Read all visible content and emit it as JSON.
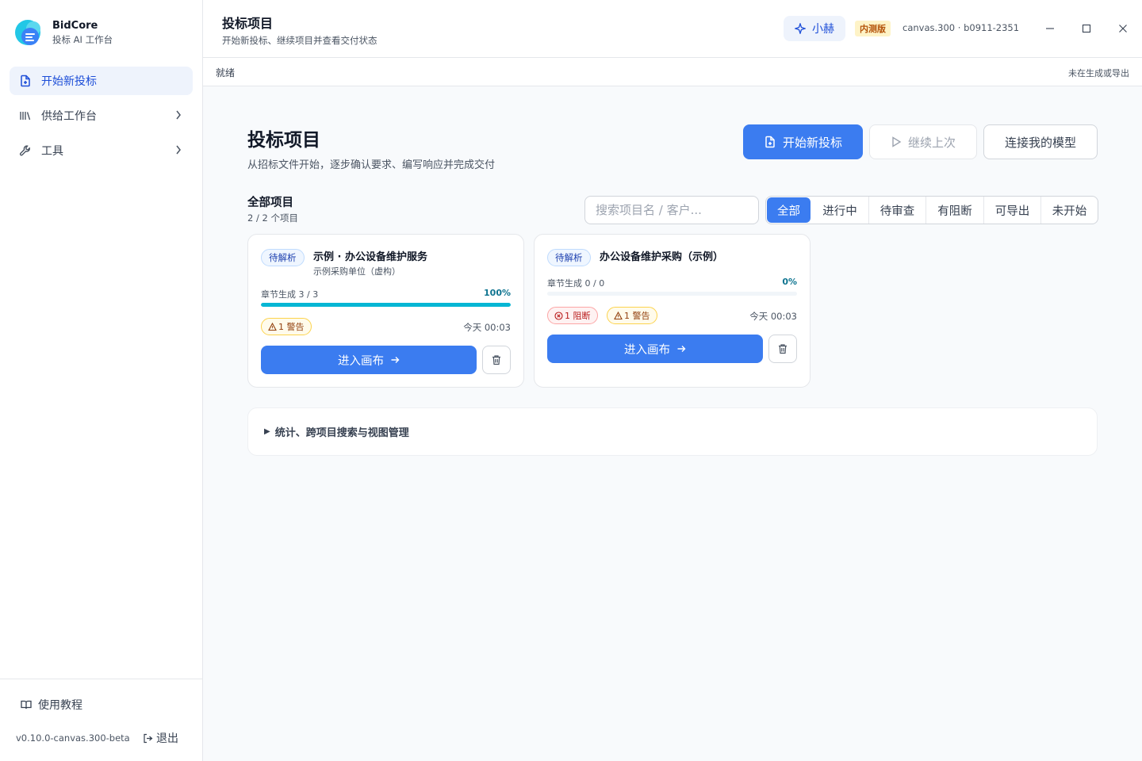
{
  "brand": {
    "name": "BidCore",
    "subtitle": "投标 AI 工作台"
  },
  "sidebar": {
    "items": [
      {
        "label": "开始新投标",
        "icon": "file-plus-icon",
        "active": true
      },
      {
        "label": "供给工作台",
        "icon": "library-icon",
        "active": false
      },
      {
        "label": "工具",
        "icon": "wrench-icon",
        "active": false
      }
    ],
    "tutorial_label": "使用教程",
    "version": "v0.10.0-canvas.300-beta",
    "logout_label": "退出"
  },
  "topbar": {
    "title": "投标项目",
    "subtitle": "开始新投标、继续项目并查看交付状态",
    "assistant_label": "小赫",
    "beta_label": "内测版",
    "build": "canvas.300 · b0911-2351"
  },
  "statusbar": {
    "left": "就绪",
    "right": "未在生成或导出"
  },
  "main": {
    "title": "投标项目",
    "subtitle": "从招标文件开始，逐步确认要求、编写响应并完成交付",
    "new_bid_label": "开始新投标",
    "continue_label": "继续上次",
    "connect_model_label": "连接我的模型",
    "section_title": "全部项目",
    "section_count": "2 / 2 个项目",
    "search_placeholder": "搜索项目名 / 客户...",
    "filters": [
      "全部",
      "进行中",
      "待审查",
      "有阻断",
      "可导出",
      "未开始"
    ],
    "active_filter": "全部",
    "stats_label": "统计、跨项目搜索与视图管理"
  },
  "projects": [
    {
      "status": "待解析",
      "title": "示例 · 办公设备维护服务",
      "client": "示例采购单位（虚构）",
      "progress_label": "章节生成 3 / 3",
      "progress_pct": "100%",
      "progress": 1.0,
      "blocks": "",
      "warnings": "1 警告",
      "time": "今天 00:03",
      "enter_label": "进入画布"
    },
    {
      "status": "待解析",
      "title": "办公设备维护采购（示例）",
      "client": "",
      "progress_label": "章节生成 0 / 0",
      "progress_pct": "0%",
      "progress": 0.0,
      "blocks": "1 阻断",
      "warnings": "1 警告",
      "time": "今天 00:03",
      "enter_label": "进入画布"
    }
  ],
  "colors": {
    "accent": "#3b7cf0",
    "progress": "#06b6d4",
    "warning": "#92400e",
    "blocker": "#b91c1c"
  }
}
